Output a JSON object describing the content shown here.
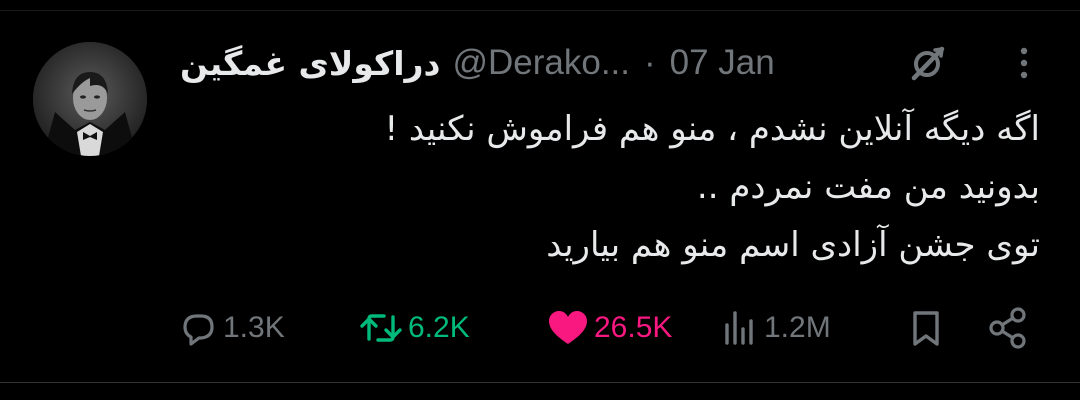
{
  "tweet": {
    "display_name": "دراکولای غمگین",
    "handle": "@Derako...",
    "separator": "·",
    "date": "07 Jan",
    "text_lines": [
      "اگه دیگه آنلاین نشدم ، منو هم فراموش نکنید !",
      "بدونید من مفت نمردم ..",
      "توی جشن آزادی اسم منو هم بیارید"
    ]
  },
  "actions": {
    "replies": "1.3K",
    "reposts": "6.2K",
    "likes": "26.5K",
    "views": "1.2M"
  },
  "icons": {
    "avatar": "avatar",
    "grok": "grok-icon",
    "more": "more-icon",
    "reply": "reply-icon",
    "retweet": "retweet-icon",
    "like": "heart-icon",
    "views": "views-icon",
    "bookmark": "bookmark-icon",
    "share": "share-icon"
  },
  "colors": {
    "background": "#000000",
    "text_primary": "#e7e9ea",
    "text_secondary": "#71767b",
    "retweet_green": "#00ba7c",
    "like_pink": "#f91880"
  }
}
